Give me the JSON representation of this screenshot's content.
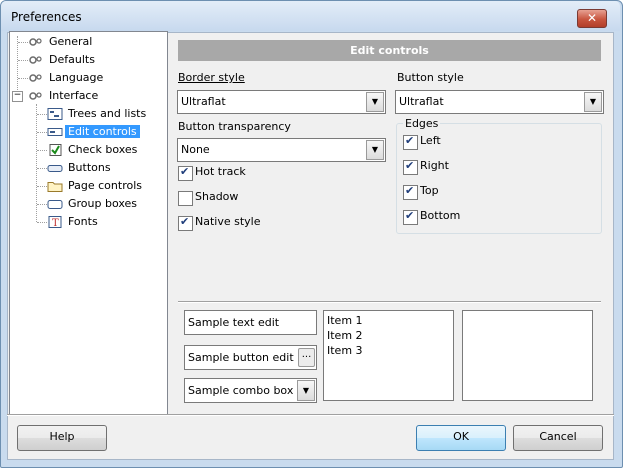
{
  "window": {
    "title": "Preferences",
    "close_glyph": "✕"
  },
  "tree": {
    "items": [
      {
        "label": "General",
        "icon": "settings-icon"
      },
      {
        "label": "Defaults",
        "icon": "settings-icon"
      },
      {
        "label": "Language",
        "icon": "settings-icon"
      },
      {
        "label": "Interface",
        "icon": "settings-icon",
        "expander": "−"
      },
      {
        "label": "Trees and lists",
        "icon": "tree-list-icon"
      },
      {
        "label": "Edit controls",
        "icon": "edit-control-icon",
        "selected": true
      },
      {
        "label": "Check boxes",
        "icon": "checkbox-icon"
      },
      {
        "label": "Buttons",
        "icon": "button-icon"
      },
      {
        "label": "Page controls",
        "icon": "folder-tab-icon"
      },
      {
        "label": "Group boxes",
        "icon": "group-box-icon"
      },
      {
        "label": "Fonts",
        "icon": "font-icon"
      }
    ]
  },
  "panel": {
    "header": "Edit controls",
    "border_style": {
      "label": "Border style",
      "value": "Ultraflat"
    },
    "button_style": {
      "label": "Button style",
      "value": "Ultraflat"
    },
    "button_transparency": {
      "label": "Button transparency",
      "value": "None"
    },
    "checks": [
      {
        "label": "Hot track",
        "checked": true
      },
      {
        "label": "Shadow",
        "checked": false
      },
      {
        "label": "Native style",
        "checked": true
      }
    ],
    "edges": {
      "title": "Edges",
      "items": [
        {
          "label": "Left",
          "checked": true
        },
        {
          "label": "Right",
          "checked": true
        },
        {
          "label": "Top",
          "checked": true
        },
        {
          "label": "Bottom",
          "checked": true
        }
      ]
    }
  },
  "sample": {
    "text_edit": "Sample text edit",
    "button_edit": "Sample button edit",
    "button_edit_glyph": "...",
    "combo_box": "Sample combo box",
    "list_items": [
      "Item 1",
      "Item 2",
      "Item 3"
    ]
  },
  "buttons": {
    "help": "Help",
    "ok": "OK",
    "cancel": "Cancel"
  },
  "colors": {
    "selection": "#3399ff",
    "header_bg": "#a8a8a8",
    "title_bar": "#c7d9ee"
  }
}
